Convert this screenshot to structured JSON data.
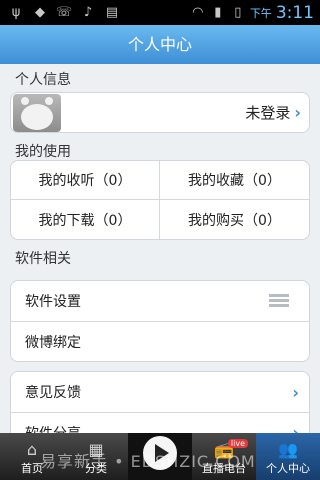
{
  "status_bar": {
    "icons": [
      "usb-icon",
      "android-icon",
      "missed-call-icon",
      "music-icon",
      "message-icon",
      "wifi-icon",
      "signal-icon",
      "battery-icon"
    ],
    "time_prefix": "下午",
    "time": "3:11"
  },
  "header": {
    "title": "个人中心"
  },
  "profile": {
    "section_title": "个人信息",
    "login_text": "未登录",
    "chevron": "›"
  },
  "usage": {
    "section_title": "我的使用",
    "items": [
      {
        "label": "我的收听（0）"
      },
      {
        "label": "我的收藏（0）"
      },
      {
        "label": "我的下载（0）"
      },
      {
        "label": "我的购买（0）"
      }
    ]
  },
  "software": {
    "section_title": "软件相关",
    "items": [
      {
        "label": "软件设置"
      },
      {
        "label": "微博绑定"
      }
    ]
  },
  "more": {
    "items": [
      {
        "label": "意见反馈",
        "chevron": "›"
      },
      {
        "label": "软件分享",
        "chevron": "›"
      }
    ]
  },
  "tabs": [
    {
      "label": "首页",
      "icon": "home-icon"
    },
    {
      "label": "分类",
      "icon": "grid-icon"
    },
    {
      "label": "",
      "icon": "play-icon"
    },
    {
      "label": "直播电台",
      "icon": "radio-icon",
      "badge": "live"
    },
    {
      "label": "个人中心",
      "icon": "person-icon",
      "active": true
    }
  ],
  "watermark": "易享新手 • EDSHZIC.COM",
  "colors": {
    "accent": "#3f8fd6",
    "chevron": "#3c8fd0",
    "live_badge": "#e23b3b"
  }
}
